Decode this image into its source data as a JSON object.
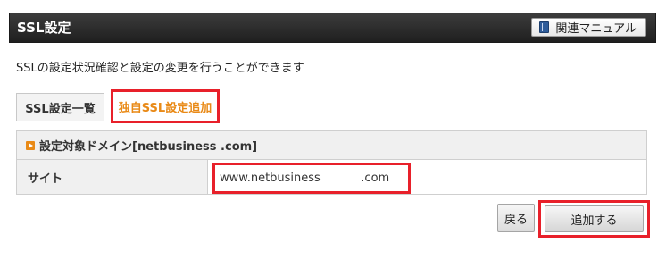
{
  "header": {
    "title": "SSL設定",
    "manual_button_label": "関連マニュアル",
    "manual_icon": "book-icon"
  },
  "description": "SSLの設定状況確認と設定の変更を行うことができます",
  "tabs": [
    {
      "label": "SSL設定一覧",
      "active": false
    },
    {
      "label": "独自SSL設定追加",
      "active": true
    }
  ],
  "form": {
    "section_title": "設定対象ドメイン[netbusiness        .com]",
    "section_icon": "arrow-right-icon",
    "site_label": "サイト",
    "site_value": "www.netbusiness           .com"
  },
  "buttons": {
    "back_label": "戻る",
    "submit_label": "追加する"
  },
  "colors": {
    "header_bg": "#2a2a2a",
    "highlight_red": "#e8202a",
    "active_tab_text": "#e98a17",
    "table_label_bg": "#f0f0f0"
  }
}
